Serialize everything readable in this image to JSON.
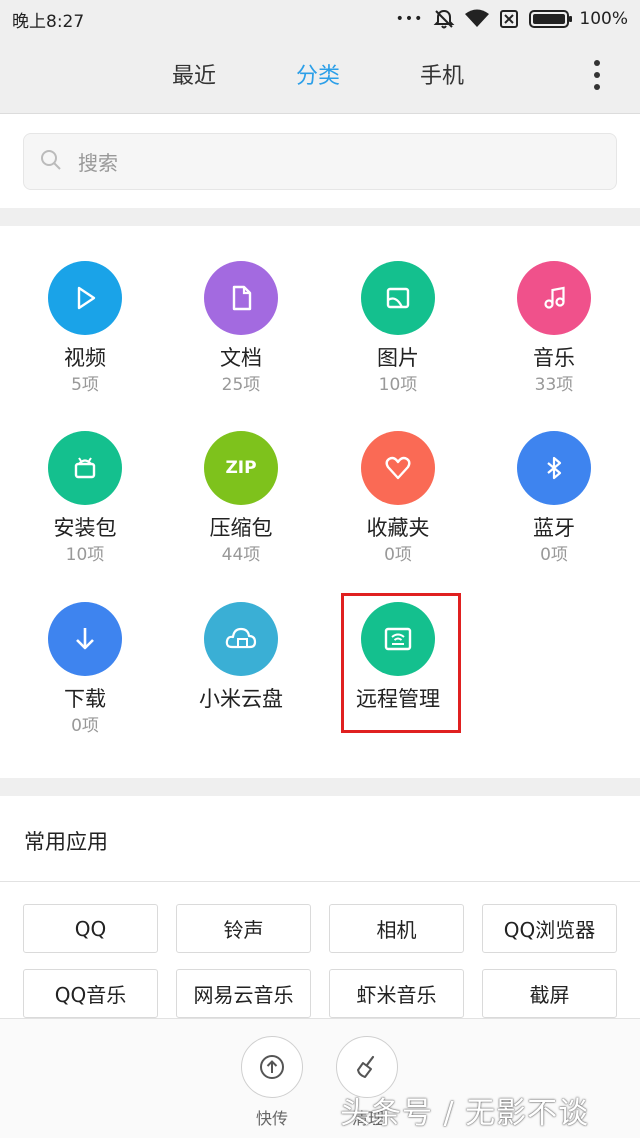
{
  "status_bar": {
    "time": "晚上8:27",
    "dots": "•••",
    "battery_percent": "100%",
    "battery_level": 1.0
  },
  "tabs": [
    {
      "label": "最近",
      "active": false
    },
    {
      "label": "分类",
      "active": true
    },
    {
      "label": "手机",
      "active": false
    }
  ],
  "search": {
    "placeholder": "搜索"
  },
  "categories": [
    {
      "name": "视频",
      "count": "5项",
      "icon": "play-icon",
      "color": "#1aa3e8"
    },
    {
      "name": "文档",
      "count": "25项",
      "icon": "document-icon",
      "color": "#a36ae0"
    },
    {
      "name": "图片",
      "count": "10项",
      "icon": "image-icon",
      "color": "#14c08e"
    },
    {
      "name": "音乐",
      "count": "33项",
      "icon": "music-icon",
      "color": "#f0518b"
    },
    {
      "name": "安装包",
      "count": "10项",
      "icon": "android-package-icon",
      "color": "#14c08e"
    },
    {
      "name": "压缩包",
      "count": "44项",
      "icon": "zip-icon",
      "icon_text": "ZIP",
      "color": "#7ec21c"
    },
    {
      "name": "收藏夹",
      "count": "0项",
      "icon": "heart-icon",
      "color": "#fa6a55"
    },
    {
      "name": "蓝牙",
      "count": "0项",
      "icon": "bluetooth-icon",
      "color": "#3e84ef"
    },
    {
      "name": "下载",
      "count": "0项",
      "icon": "download-icon",
      "color": "#3e84ef"
    },
    {
      "name": "小米云盘",
      "count": "",
      "icon": "cloud-drive-icon",
      "color": "#3aafd5"
    },
    {
      "name": "远程管理",
      "count": "",
      "icon": "remote-manage-icon",
      "color": "#14c08e"
    }
  ],
  "common_apps": {
    "title": "常用应用",
    "items": [
      "QQ",
      "铃声",
      "相机",
      "QQ浏览器",
      "QQ音乐",
      "网易云音乐",
      "虾米音乐",
      "截屏"
    ]
  },
  "bottom_bar": {
    "quick_send_label": "快传",
    "clean_label": "清理"
  },
  "watermark": "头条号 / 无影不谈"
}
